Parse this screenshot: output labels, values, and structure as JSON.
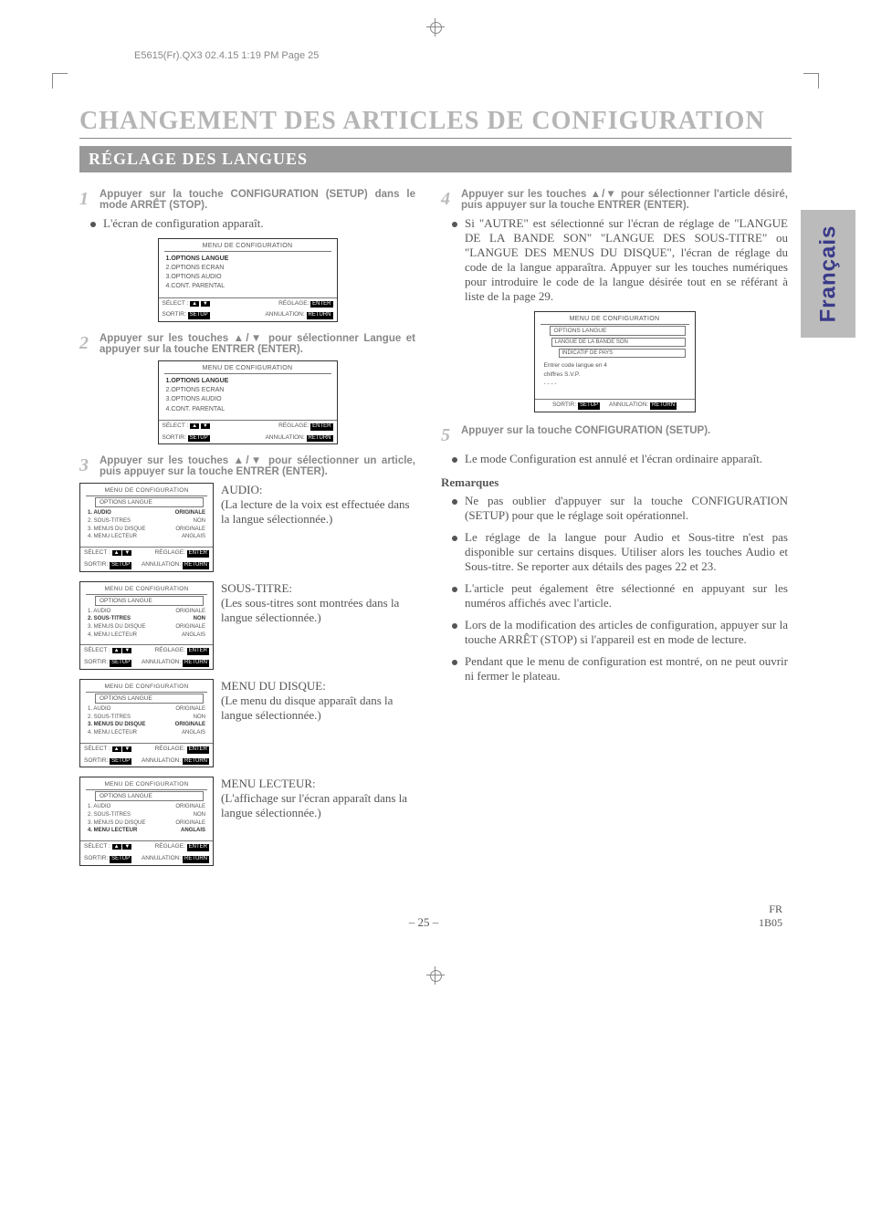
{
  "header_line": "E5615(Fr).QX3  02.4.15 1:19 PM  Page 25",
  "main_title": "CHANGEMENT DES ARTICLES DE CONFIGURATION",
  "section_title": "RÉGLAGE DES LANGUES",
  "side_tab": "Français",
  "steps": {
    "s1": "Appuyer sur la touche CONFIGURATION (SETUP) dans le mode ARRÊT (STOP).",
    "s1_bullet": "L'écran de configuration apparaît.",
    "s2": "Appuyer sur les touches ▲/▼ pour sélectionner Langue et appuyer sur la touche ENTRER (ENTER).",
    "s3": "Appuyer sur les touches ▲/▼ pour sélectionner un article, puis appuyer sur la touche ENTRER (ENTER).",
    "s4": "Appuyer sur les touches ▲/▼ pour sélectionner l'article désiré, puis appuyer sur la touche ENTRER (ENTER).",
    "s4_bullet": "Si \"AUTRE\" est sélectionné sur l'écran de réglage de \"LANGUE DE LA BANDE SON\" \"LANGUE DES SOUS-TITRE\" ou \"LANGUE DES MENUS DU DISQUE\", l'écran de réglage du code de la langue apparaîtra. Appuyer sur les touches numériques pour introduire le code de la langue désirée tout en se référant à liste de la page 29.",
    "s5": "Appuyer sur la touche CONFIGURATION (SETUP).",
    "s5_bullet": "Le mode Configuration est annulé et l'écran ordinaire apparaît."
  },
  "osd_main": {
    "title": "MENU DE CONFIGURATION",
    "items": [
      "1.OPTIONS LANGUE",
      "2.OPTIONS ECRAN",
      "3.OPTIONS AUDIO",
      "4.CONT. PARENTAL"
    ],
    "footer_select": "SÉLECT :",
    "footer_reglage": "RÉGLAGE:",
    "footer_sortir": "SORTIR:",
    "footer_annul": "ANNULATION:",
    "btn_enter": "ENTER",
    "btn_setup": "SETUP",
    "btn_return": "RETURN"
  },
  "osd_lang": {
    "title": "MENU DE CONFIGURATION",
    "subtitle": "OPTIONS LANGUE",
    "rows": [
      {
        "l": "1. AUDIO",
        "r": "ORIGINALE"
      },
      {
        "l": "2. SOUS-TITRES",
        "r": "NON"
      },
      {
        "l": "3. MENUS DU DISQUE",
        "r": "ORIGINALE"
      },
      {
        "l": "4. MENU LECTEUR",
        "r": "ANGLAIS"
      }
    ]
  },
  "osd_code": {
    "title": "MENU DE CONFIGURATION",
    "sub1": "OPTIONS LANGUE",
    "sub2": "LANGUE DE LA BANDE SON",
    "sub3": "INDICATIF DE PAYS",
    "body1": "Entrer code langue en 4",
    "body2": "chiffres S.V.P.",
    "body3": "- - - -"
  },
  "options": {
    "audio": {
      "head": "AUDIO:",
      "text": "(La lecture de la voix est effectuée dans la langue sélectionnée.)",
      "bold_idx": 0
    },
    "subtitle": {
      "head": "SOUS-TITRE:",
      "text": "(Les sous-titres sont montrées dans la langue sélectionnée.)",
      "bold_idx": 1
    },
    "disc": {
      "head": "MENU DU DISQUE:",
      "text": "(Le menu du disque apparaît dans la langue sélectionnée.)",
      "bold_idx": 2
    },
    "player": {
      "head": "MENU LECTEUR:",
      "text": "(L'affichage sur l'écran apparaît dans la langue sélectionnée.)",
      "bold_idx": 3
    }
  },
  "remarks": {
    "head": "Remarques",
    "items": [
      "Ne pas oublier d'appuyer sur la touche CONFIGURATION (SETUP) pour que le réglage soit opérationnel.",
      "Le réglage de la langue pour Audio et Sous-titre n'est pas disponible sur certains disques. Utiliser alors les touches Audio et Sous-titre. Se reporter aux détails des pages 22 et 23.",
      "L'article peut également être sélectionné en appuyant sur les numéros affichés avec l'article.",
      "Lors de la modification des articles de configuration, appuyer sur la touche ARRÊT (STOP) si l'appareil est en mode de lecture.",
      "Pendant que le menu de configuration est montré, on ne peut ouvrir ni fermer le plateau."
    ]
  },
  "footer": {
    "page": "– 25 –",
    "fr": "FR",
    "code": "1B05"
  }
}
